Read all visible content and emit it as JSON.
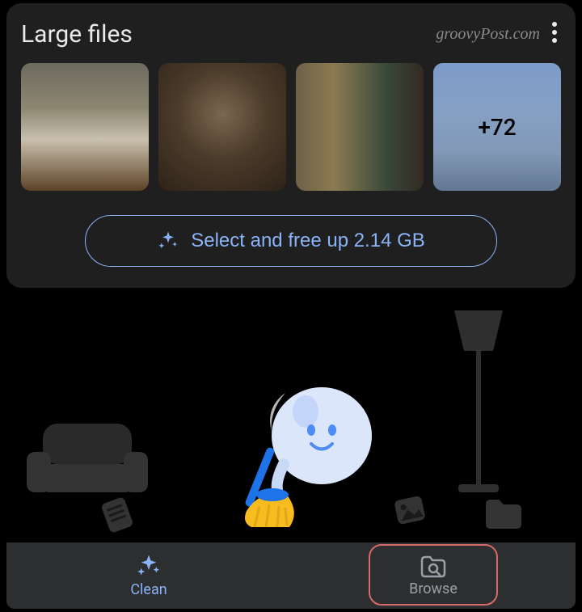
{
  "card": {
    "title": "Large files",
    "watermark": "groovyPost.com",
    "more_count_label": "+72",
    "action_label": "Select and free up 2.14 GB"
  },
  "nav": {
    "clean_label": "Clean",
    "browse_label": "Browse"
  }
}
